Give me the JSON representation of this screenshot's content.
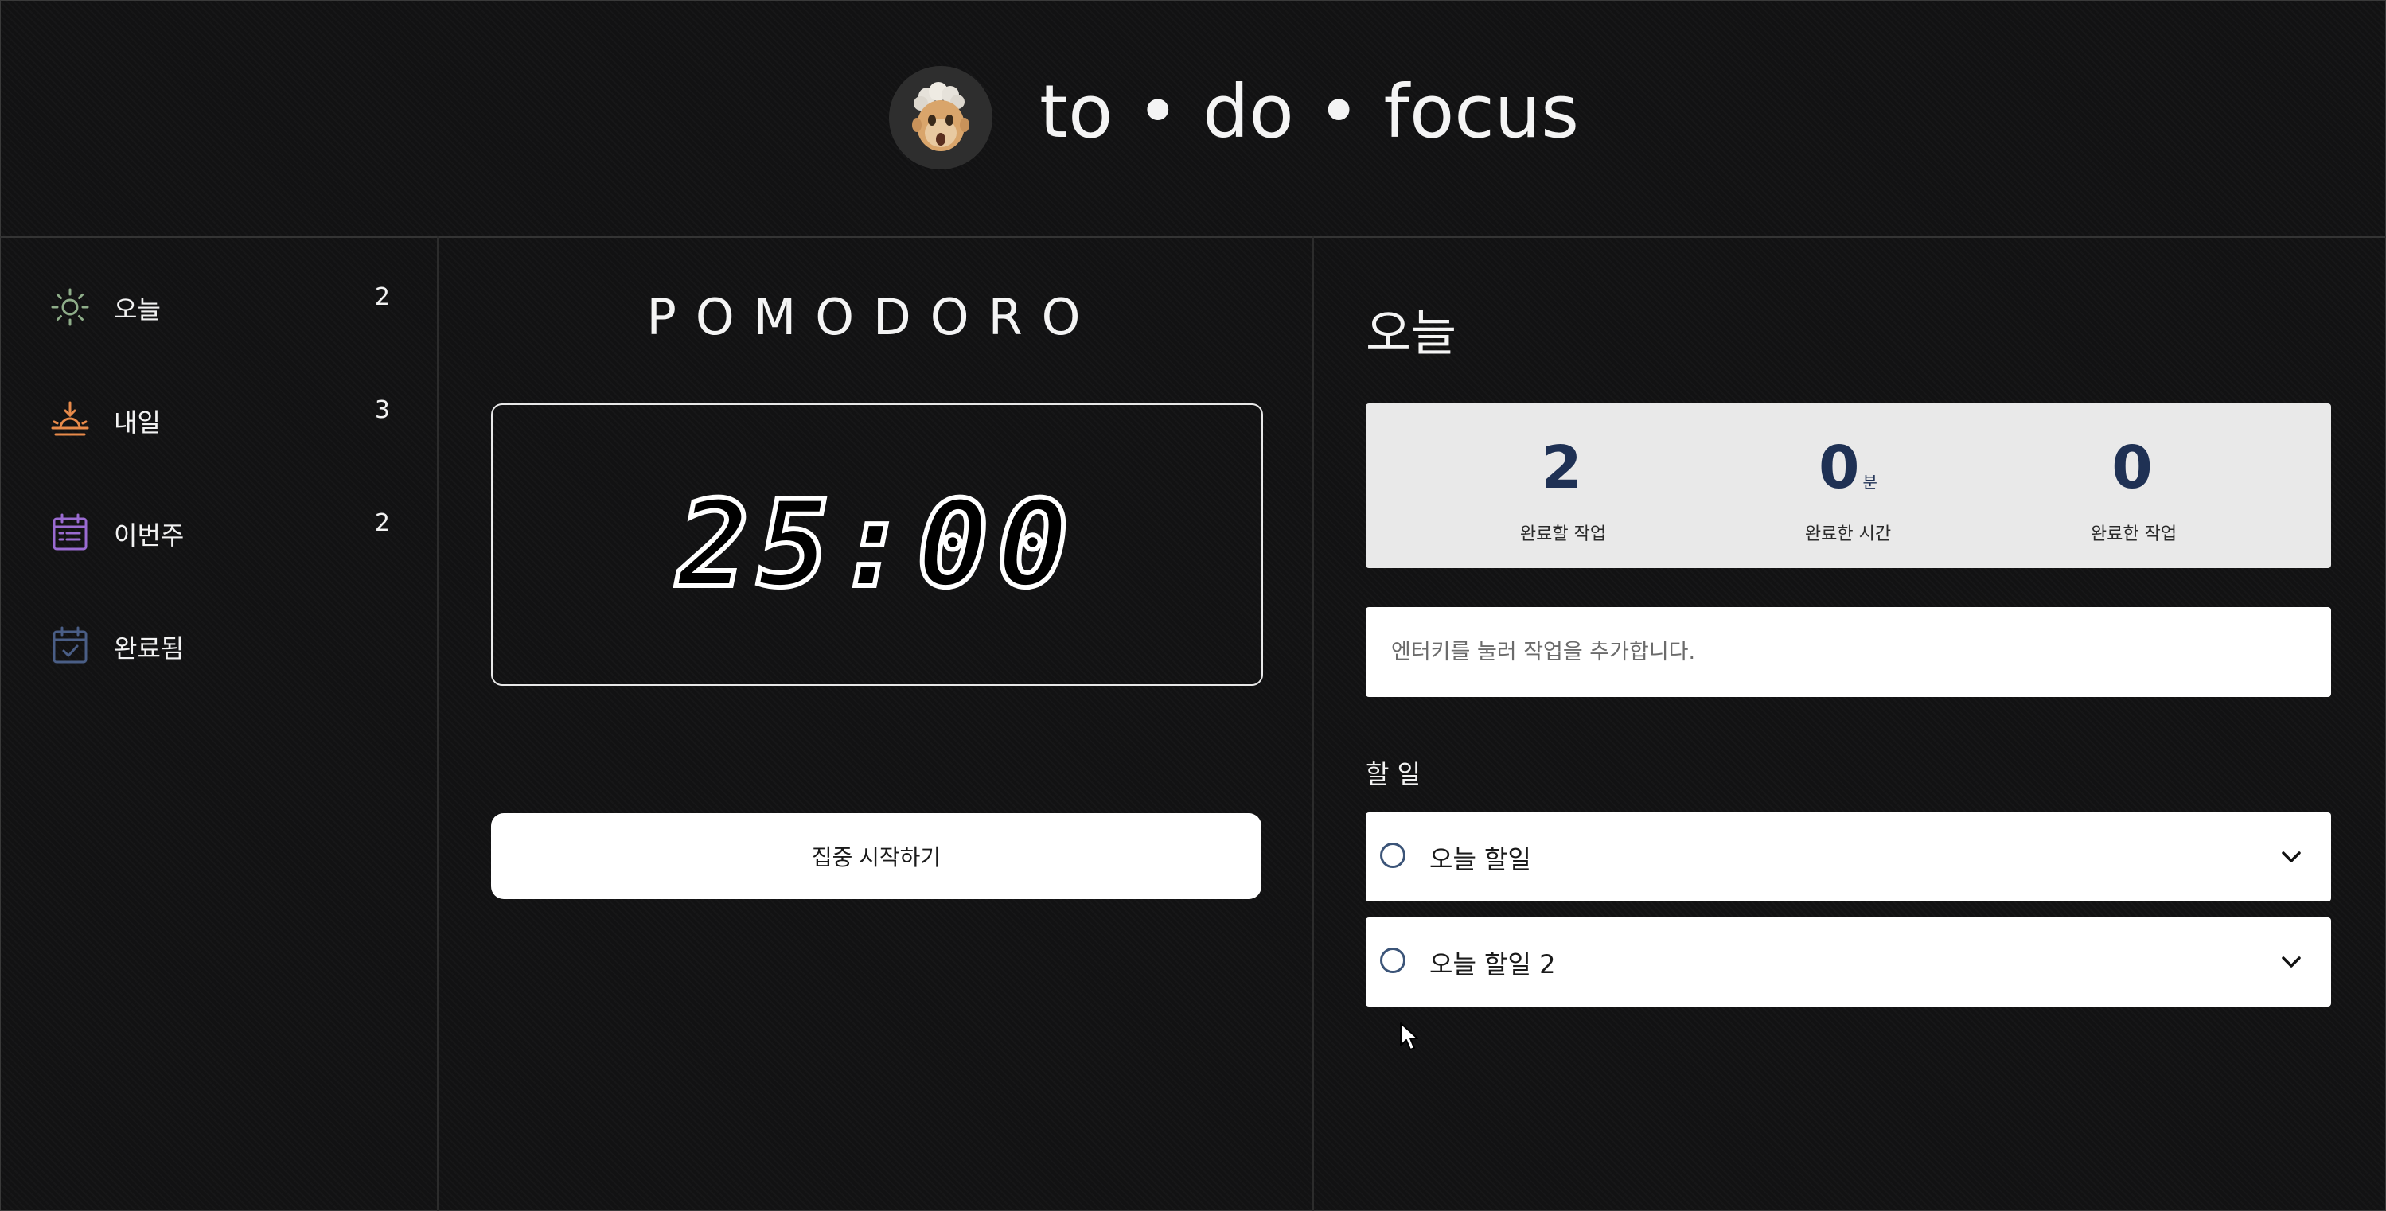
{
  "app": {
    "brand": "to • do • focus"
  },
  "sidebar": {
    "items": [
      {
        "label": "오늘",
        "count": "2",
        "icon": "sun-icon",
        "color": "#8fae8a"
      },
      {
        "label": "내일",
        "count": "3",
        "icon": "sunrise-icon",
        "color": "#e88a4a"
      },
      {
        "label": "이번주",
        "count": "2",
        "icon": "calendar-week-icon",
        "color": "#9a6bd1"
      },
      {
        "label": "완료됨",
        "count": "",
        "icon": "calendar-check-icon",
        "color": "#4a5e86"
      }
    ]
  },
  "pomodoro": {
    "title": "POMODORO",
    "time": "25:00",
    "start_label": "집중 시작하기"
  },
  "main": {
    "title": "오늘",
    "stats": [
      {
        "value": "2",
        "unit": "",
        "caption": "완료할 작업"
      },
      {
        "value": "0",
        "unit": "분",
        "caption": "완료한 시간"
      },
      {
        "value": "0",
        "unit": "",
        "caption": "완료한 작업"
      }
    ],
    "input_placeholder": "엔터키를 눌러 작업을 추가합니다.",
    "todo_heading": "할 일",
    "todos": [
      {
        "label": "오늘 할일"
      },
      {
        "label": "오늘 할일 2"
      }
    ]
  },
  "colors": {
    "background": "#121213",
    "accent_navy": "#1f3154",
    "stats_bg": "#e9e9e9"
  }
}
